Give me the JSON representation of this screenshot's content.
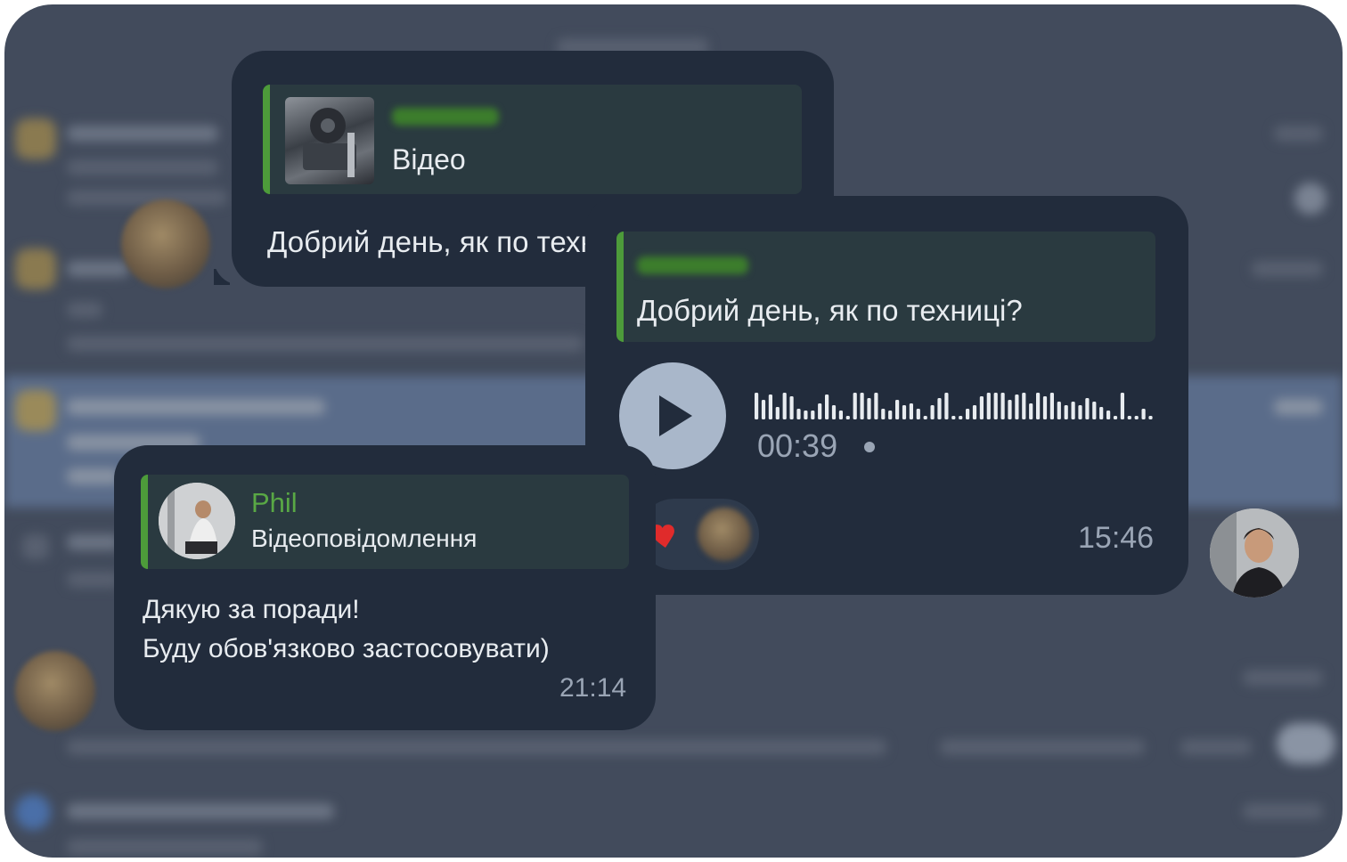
{
  "bubble_video": {
    "quote_label": "Відео",
    "message": "Добрий день, як по техниці?"
  },
  "bubble_voice": {
    "quote_text": "Добрий день, як по техниці?",
    "duration": "00:39",
    "time": "15:46",
    "reaction": "heart"
  },
  "bubble_phil": {
    "sender": "Phil",
    "quote_label": "Відеоповідомлення",
    "line1": "Дякую за поради!",
    "line2": "Буду обов'язково застосовувати)",
    "time": "21:14"
  },
  "colors": {
    "bubble": "#222c3c",
    "quote_bar": "#4d9b3a",
    "quote_bg": "#2a3a40",
    "play_button": "#a9b7ca",
    "background": "#424b5c",
    "reaction_heart": "#e02b2b"
  },
  "icons": {
    "play": "play-icon",
    "heart": "heart-icon"
  }
}
